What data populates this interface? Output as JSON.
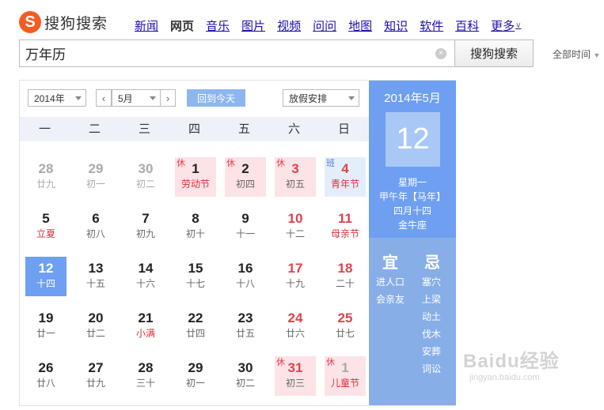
{
  "logo": {
    "mark": "S",
    "text": "搜狗搜索"
  },
  "nav": [
    "新闻",
    "网页",
    "音乐",
    "图片",
    "视频",
    "问问",
    "地图",
    "知识",
    "软件",
    "百科",
    "更多"
  ],
  "nav_active_index": 1,
  "search": {
    "value": "万年历",
    "button": "搜狗搜索",
    "time_filter": "全部时间",
    "clear": "×"
  },
  "calendar": {
    "year_select": "2014年",
    "month_select": "5月",
    "prev": "‹",
    "next": "›",
    "today_button": "回到今天",
    "holiday_select": "放假安排",
    "weekdays": [
      "一",
      "二",
      "三",
      "四",
      "五",
      "六",
      "日"
    ],
    "weeks": [
      [
        {
          "n": "28",
          "l": "廿九",
          "type": "other"
        },
        {
          "n": "29",
          "l": "初一",
          "type": "other"
        },
        {
          "n": "30",
          "l": "初二",
          "type": "other"
        },
        {
          "n": "1",
          "l": "劳动节",
          "type": "holiday",
          "tag": "休",
          "festival": true
        },
        {
          "n": "2",
          "l": "初四",
          "type": "holiday",
          "tag": "休"
        },
        {
          "n": "3",
          "l": "初五",
          "type": "holiday",
          "tag": "休",
          "weekend": true
        },
        {
          "n": "4",
          "l": "青年节",
          "type": "workday",
          "tag": "班",
          "weekend": true,
          "festival": true
        }
      ],
      [
        {
          "n": "5",
          "l": "立夏",
          "festival": true
        },
        {
          "n": "6",
          "l": "初八"
        },
        {
          "n": "7",
          "l": "初九"
        },
        {
          "n": "8",
          "l": "初十"
        },
        {
          "n": "9",
          "l": "十一"
        },
        {
          "n": "10",
          "l": "十二",
          "weekend": true
        },
        {
          "n": "11",
          "l": "母亲节",
          "weekend": true,
          "festival": true
        }
      ],
      [
        {
          "n": "12",
          "l": "十四",
          "today": true
        },
        {
          "n": "13",
          "l": "十五"
        },
        {
          "n": "14",
          "l": "十六"
        },
        {
          "n": "15",
          "l": "十七"
        },
        {
          "n": "16",
          "l": "十八"
        },
        {
          "n": "17",
          "l": "十九",
          "weekend": true
        },
        {
          "n": "18",
          "l": "二十",
          "weekend": true
        }
      ],
      [
        {
          "n": "19",
          "l": "廿一"
        },
        {
          "n": "20",
          "l": "廿二"
        },
        {
          "n": "21",
          "l": "小满",
          "festival": true
        },
        {
          "n": "22",
          "l": "廿四"
        },
        {
          "n": "23",
          "l": "廿五"
        },
        {
          "n": "24",
          "l": "廿六",
          "weekend": true
        },
        {
          "n": "25",
          "l": "廿七",
          "weekend": true
        }
      ],
      [
        {
          "n": "26",
          "l": "廿八"
        },
        {
          "n": "27",
          "l": "廿九"
        },
        {
          "n": "28",
          "l": "三十"
        },
        {
          "n": "29",
          "l": "初一"
        },
        {
          "n": "30",
          "l": "初二"
        },
        {
          "n": "31",
          "l": "初三",
          "type": "holiday",
          "tag": "休",
          "weekend": true
        },
        {
          "n": "1",
          "l": "儿童节",
          "type": "holiday",
          "tag": "休",
          "other": true,
          "festival": true
        }
      ]
    ]
  },
  "side": {
    "year_month": "2014年5月",
    "day": "12",
    "weekday": "星期一",
    "ganzhi": "甲午年【马年】",
    "lunar": "四月十四",
    "constellation": "金牛座",
    "yi_label": "宜",
    "ji_label": "忌",
    "yi": [
      "进人口",
      "会亲友"
    ],
    "ji": [
      "塞穴",
      "上梁",
      "动土",
      "伐木",
      "安葬",
      "词讼"
    ]
  },
  "watermark": {
    "main": "Baidu经验",
    "sub": "jingyan.baidu.com"
  },
  "colors": {
    "accent": "#6e9ff0",
    "holiday_bg": "#fbe3e6",
    "workday_bg": "#e4eefb",
    "weekend_red": "#e0424b",
    "logo": "#f45d22"
  }
}
